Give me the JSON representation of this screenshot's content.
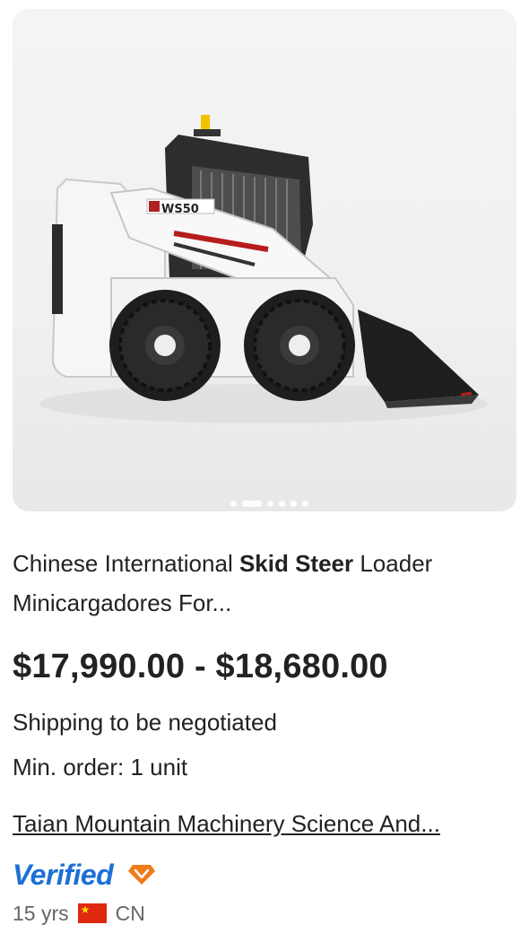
{
  "product": {
    "image_alt": "WS50 skid steer loader",
    "image_model_text": "WS50",
    "carousel": {
      "total": 6,
      "active": 1
    },
    "title_prefix": "Chinese International ",
    "title_bold": "Skid Steer",
    "title_suffix": " Loader Minicargadores For...",
    "price": "$17,990.00 - $18,680.00",
    "shipping": "Shipping to be negotiated",
    "min_order": "Min. order: 1 unit"
  },
  "supplier": {
    "name": "Taian Mountain Machinery Science And...",
    "verified_label": "Verified",
    "years": "15 yrs",
    "country": "CN",
    "flag_icon": "china-flag-icon",
    "badge_icon": "diamond-badge-icon"
  },
  "colors": {
    "verified_blue": "#1c6fd6",
    "badge_orange": "#f07b1a",
    "text": "#222222",
    "muted": "#666666"
  }
}
